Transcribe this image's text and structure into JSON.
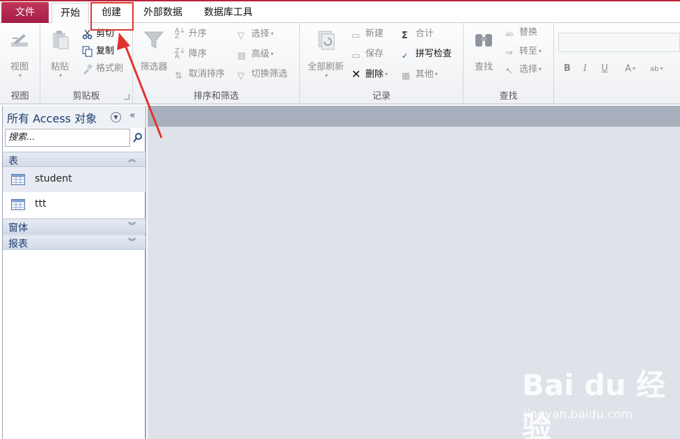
{
  "tabs": {
    "file": "文件",
    "home": "开始",
    "create": "创建",
    "external": "外部数据",
    "dbtools": "数据库工具"
  },
  "ribbon": {
    "views": {
      "view": "视图",
      "group": "视图"
    },
    "clipboard": {
      "paste": "粘贴",
      "cut": "剪切",
      "copy": "复制",
      "format_painter": "格式刷",
      "group": "剪贴板"
    },
    "sort_filter": {
      "filter": "筛选器",
      "ascending": "升序",
      "descending": "降序",
      "remove_sort": "取消排序",
      "selection": "选择",
      "advanced": "高级",
      "toggle_filter": "切换筛选",
      "group": "排序和筛选"
    },
    "records": {
      "refresh_all": "全部刷新",
      "new": "新建",
      "save": "保存",
      "delete": "删除",
      "totals": "合计",
      "spelling": "拼写检查",
      "more": "其他",
      "group": "记录"
    },
    "find": {
      "find": "查找",
      "replace": "替换",
      "goto": "转至",
      "select": "选择",
      "group": "查找"
    },
    "text_format": {
      "bold": "B",
      "italic": "I",
      "underline": "U"
    }
  },
  "nav": {
    "title": "所有 Access 对象",
    "search_placeholder": "搜索...",
    "sections": {
      "tables": "表",
      "forms": "窗体",
      "reports": "报表"
    },
    "tables": [
      "student",
      "ttt"
    ]
  },
  "watermark": {
    "brand": "Bai du 经验",
    "url": "jingyan.baidu.com"
  },
  "colors": {
    "file_tab": "#b8243a",
    "annotation": "#e2322d",
    "nav_text": "#1e3b6f"
  }
}
